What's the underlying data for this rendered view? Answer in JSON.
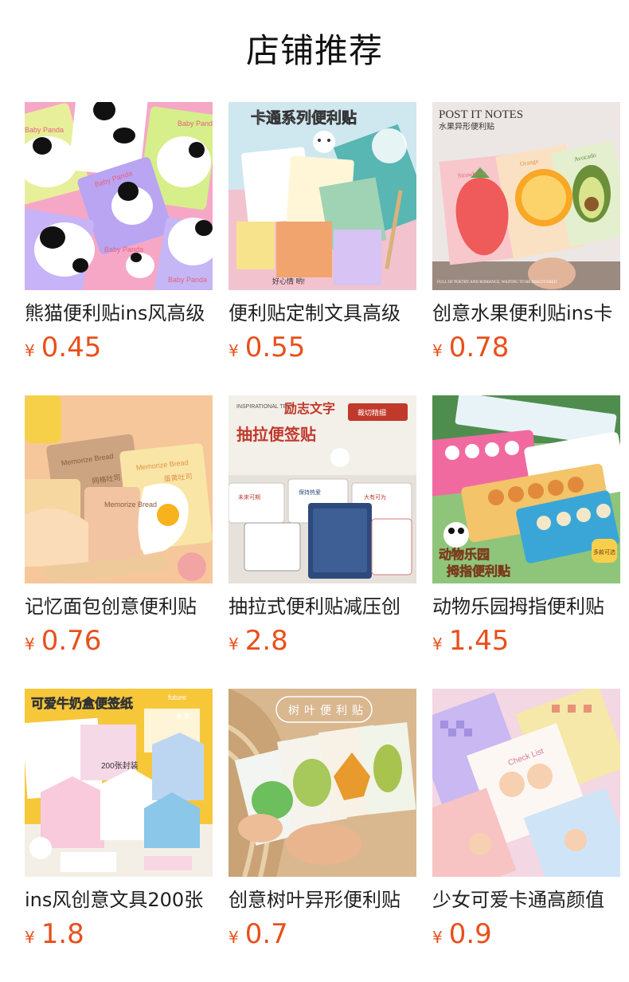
{
  "page": {
    "title": "店铺推荐"
  },
  "theme": {
    "price_color": "#e8501b"
  },
  "products": [
    {
      "title": "熊猫便利贴ins风高级",
      "currency": "¥",
      "price": "0.45",
      "image_text": [
        "Baby Panda",
        "Baby Panda",
        "Baby Panda",
        "Baby Panda",
        "Baby Panda"
      ]
    },
    {
      "title": "便利贴定制文具高级",
      "currency": "¥",
      "price": "0.55",
      "image_text": [
        "卡通系列便利贴",
        "好心情 哟!"
      ]
    },
    {
      "title": "创意水果便利贴ins卡",
      "currency": "¥",
      "price": "0.78",
      "image_text": [
        "POST IT NOTES",
        "水果异形便利贴",
        "Strawberry",
        "Orange",
        "Avocado",
        "FULL OF POETRY AND ROMANCE, WAITING TO BE DISCOVERED"
      ]
    },
    {
      "title": "记忆面包创意便利贴",
      "currency": "¥",
      "price": "0.76",
      "image_text": [
        "Memorize Bread",
        "网格吐司",
        "Memorize Bread",
        "Memorize Bread",
        "蛋黄吐司"
      ]
    },
    {
      "title": "抽拉式便利贴减压创",
      "currency": "¥",
      "price": "2.8",
      "image_text": [
        "INSPIRATIONAL TEXT",
        "励志文字",
        "抽拉便签贴",
        "裁切精细",
        "未来可期",
        "保持热爱",
        "大有可为"
      ]
    },
    {
      "title": "动物乐园拇指便利贴",
      "currency": "¥",
      "price": "1.45",
      "image_text": [
        "动物乐园",
        "拇指便利贴",
        "多款可选"
      ]
    },
    {
      "title": "ins风创意文具200张",
      "currency": "¥",
      "price": "1.8",
      "image_text": [
        "可爱牛奶盒便签纸",
        "future",
        "未来",
        "200张封装"
      ]
    },
    {
      "title": "创意树叶异形便利贴",
      "currency": "¥",
      "price": "0.7",
      "image_text": [
        "树叶便利贴"
      ]
    },
    {
      "title": "少女可爱卡通高颜值",
      "currency": "¥",
      "price": "0.9",
      "image_text": [
        "Check List"
      ]
    }
  ]
}
